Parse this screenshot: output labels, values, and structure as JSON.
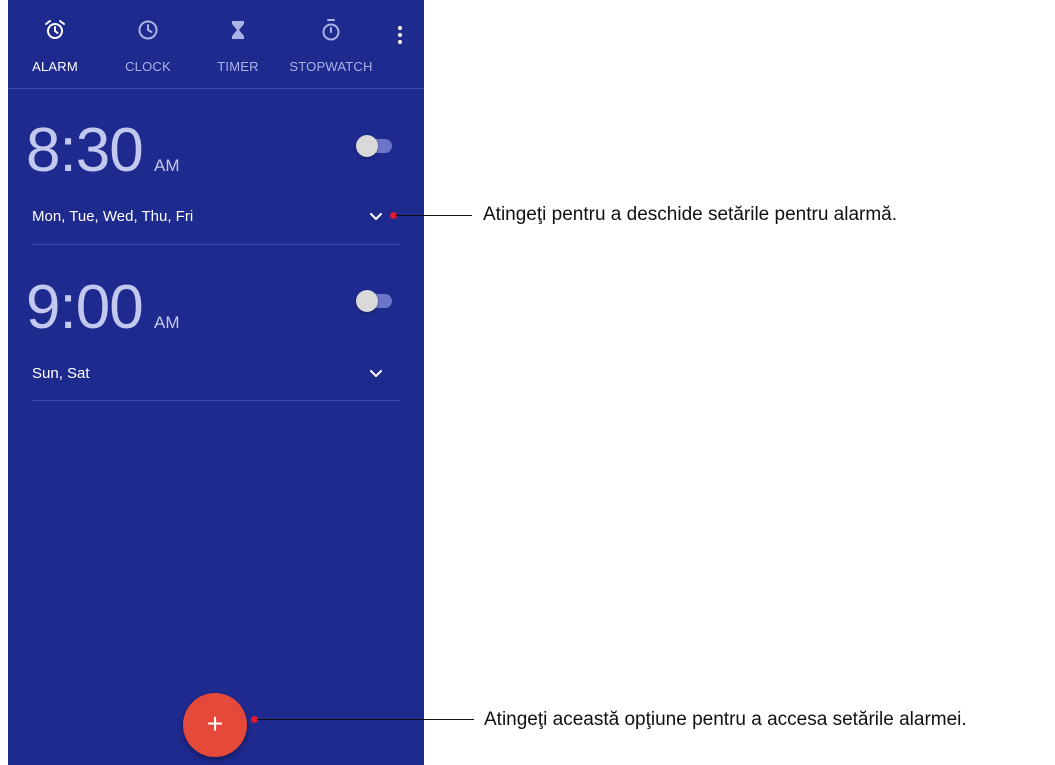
{
  "tabs": [
    {
      "label": "ALARM",
      "icon": "alarm-icon",
      "active": true
    },
    {
      "label": "CLOCK",
      "icon": "clock-icon",
      "active": false
    },
    {
      "label": "TIMER",
      "icon": "hourglass-icon",
      "active": false
    },
    {
      "label": "STOPWATCH",
      "icon": "stopwatch-icon",
      "active": false
    }
  ],
  "alarms": [
    {
      "time": "8:30",
      "ampm": "AM",
      "days": "Mon, Tue, Wed, Thu, Fri",
      "enabled": false
    },
    {
      "time": "9:00",
      "ampm": "AM",
      "days": "Sun, Sat",
      "enabled": false
    }
  ],
  "fab": {
    "label": "+"
  },
  "callouts": {
    "expand": "Atingeţi pentru a deschide setările pentru alarmă.",
    "add": "Atingeţi această opţiune pentru a accesa setările alarmei."
  },
  "colors": {
    "background": "#1f2a8f",
    "fab": "#e5493a",
    "callout_dot": "#e0192b"
  }
}
